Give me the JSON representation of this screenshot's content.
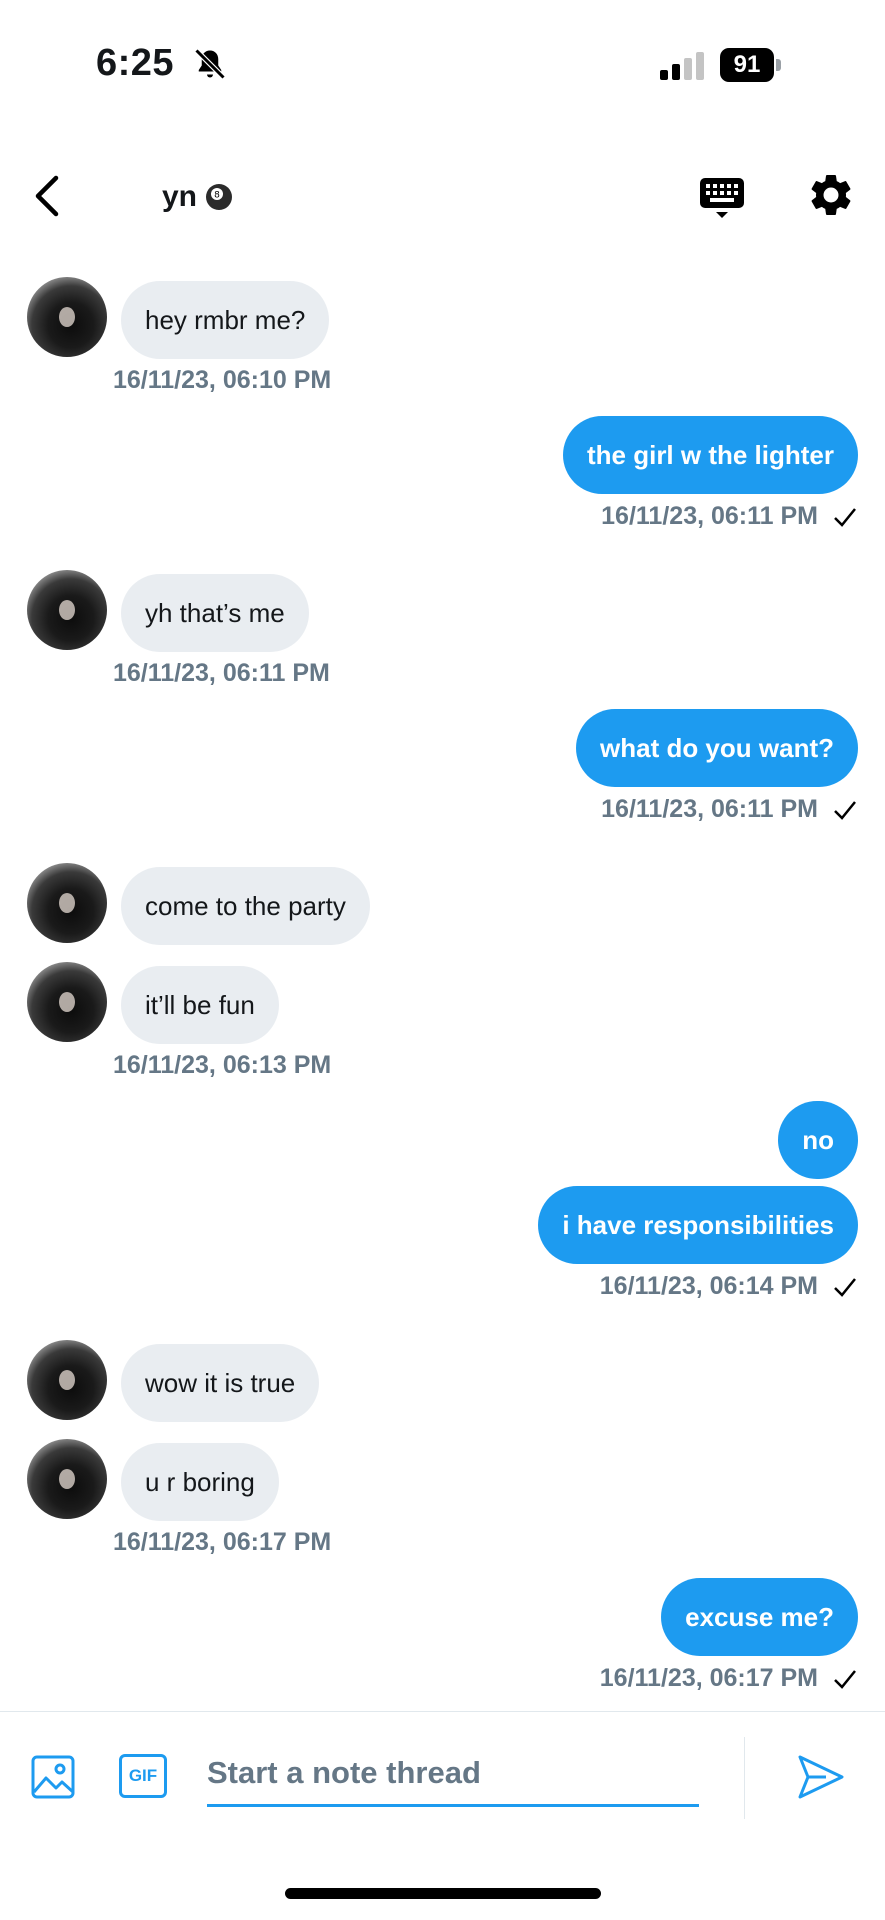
{
  "status_bar": {
    "time": "6:25",
    "battery": "91",
    "icons": [
      "bell-slash-icon",
      "signal-icon",
      "battery-icon"
    ]
  },
  "header": {
    "title": "yn",
    "title_emoji": "8-ball-icon",
    "back_icon": "chevron-left-icon",
    "keyboard_icon": "keyboard-icon",
    "settings_icon": "gear-icon"
  },
  "messages": [
    {
      "dir": "in",
      "text": "hey rmbr me?"
    },
    {
      "dir": "in",
      "timestamp": "16/11/23, 06:10 PM"
    },
    {
      "dir": "out",
      "text": "the girl w the lighter"
    },
    {
      "dir": "out",
      "timestamp": "16/11/23, 06:11 PM"
    },
    {
      "dir": "in",
      "text": "yh that’s me"
    },
    {
      "dir": "in",
      "timestamp": "16/11/23, 06:11 PM"
    },
    {
      "dir": "out",
      "text": "what do you want?"
    },
    {
      "dir": "out",
      "timestamp": "16/11/23, 06:11 PM"
    },
    {
      "dir": "in",
      "text": "come to the party"
    },
    {
      "dir": "in",
      "text": "it’ll be fun"
    },
    {
      "dir": "in",
      "timestamp": "16/11/23, 06:13 PM"
    },
    {
      "dir": "out",
      "text": "no"
    },
    {
      "dir": "out",
      "text": "i have responsibilities"
    },
    {
      "dir": "out",
      "timestamp": "16/11/23, 06:14 PM"
    },
    {
      "dir": "in",
      "text": "wow it is true"
    },
    {
      "dir": "in",
      "text": "u r boring"
    },
    {
      "dir": "in",
      "timestamp": "16/11/23, 06:17 PM"
    },
    {
      "dir": "out",
      "text": "excuse me?"
    },
    {
      "dir": "out",
      "timestamp": "16/11/23, 06:17 PM"
    }
  ],
  "composer": {
    "placeholder": "Start a note thread",
    "gif_label": "GIF",
    "image_icon": "image-icon",
    "send_icon": "send-icon"
  },
  "colors": {
    "accent": "#1d9bf0",
    "incoming_bubble": "#e9edf1",
    "timestamp": "#657786"
  }
}
